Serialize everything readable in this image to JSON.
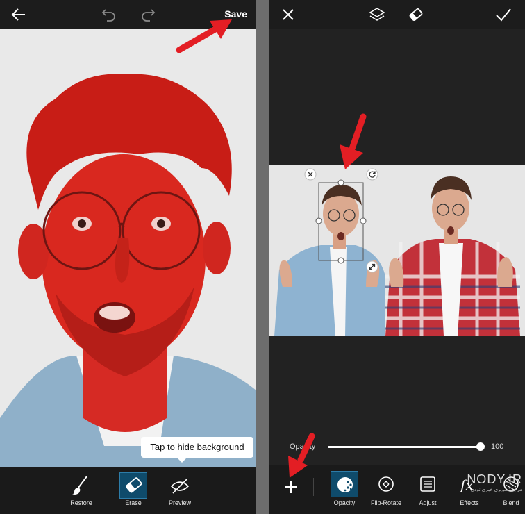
{
  "left_panel": {
    "top_bar": {
      "back_icon": "arrow-left-icon",
      "undo_icon": "undo-icon",
      "redo_icon": "redo-icon",
      "save_label": "Save"
    },
    "tooltip_text": "Tap to hide background",
    "tools": [
      {
        "label": "Restore",
        "icon": "brush-icon",
        "active": false
      },
      {
        "label": "Erase",
        "icon": "eraser-icon",
        "active": true
      },
      {
        "label": "Preview",
        "icon": "preview-icon",
        "active": false
      }
    ],
    "mask_color": "#d8231f"
  },
  "right_panel": {
    "top_bar": {
      "close_icon": "close-icon",
      "layers_icon": "layers-icon",
      "eraser_icon": "eraser-icon",
      "confirm_icon": "checkmark-icon"
    },
    "opacity": {
      "label": "Opacity",
      "value": "100",
      "fraction": 1.0
    },
    "add_icon": "plus-icon",
    "tools": [
      {
        "label": "Opacity",
        "icon": "opacity-icon",
        "active": true
      },
      {
        "label": "Flip-Rotate",
        "icon": "flip-rotate-icon",
        "active": false
      },
      {
        "label": "Adjust",
        "icon": "adjust-icon",
        "active": false
      },
      {
        "label": "Effects",
        "icon": "fx-icon",
        "active": false
      },
      {
        "label": "Blend",
        "icon": "blend-icon",
        "active": false
      }
    ]
  },
  "watermark": {
    "text": "NODY.IR",
    "subtext": "مرجع تصویری خبری نودی"
  },
  "colors": {
    "accent": "#2d7ca8",
    "annotation_arrow": "#e31e24",
    "toolbar_bg": "#1c1c1c"
  }
}
